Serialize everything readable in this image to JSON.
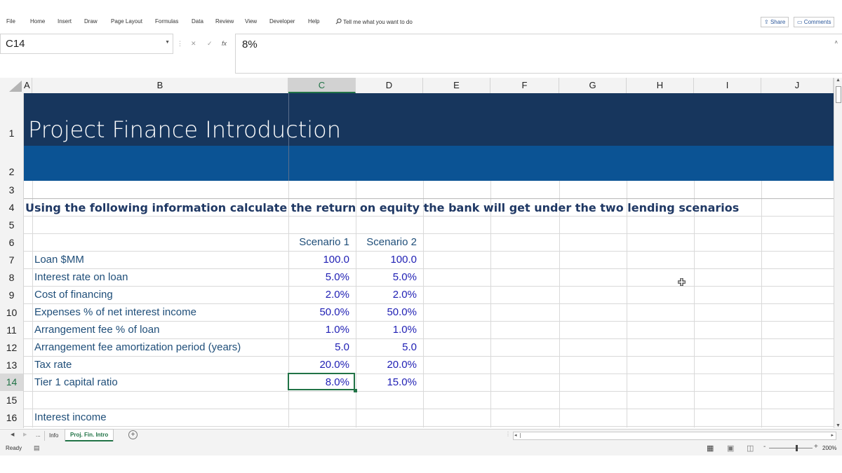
{
  "ribbon": {
    "tabs": [
      "File",
      "Home",
      "Insert",
      "Draw",
      "Page Layout",
      "Formulas",
      "Data",
      "Review",
      "View",
      "Developer",
      "Help"
    ],
    "tell_me": "Tell me what you want to do",
    "share": "Share",
    "comments": "Comments"
  },
  "formula_bar": {
    "name_box": "C14",
    "fx_label": "fx",
    "content": "8%"
  },
  "columns": [
    "A",
    "B",
    "C",
    "D",
    "E",
    "F",
    "G",
    "H",
    "I",
    "J"
  ],
  "rows": [
    "1",
    "2",
    "3",
    "4",
    "5",
    "6",
    "7",
    "8",
    "9",
    "10",
    "11",
    "12",
    "13",
    "14",
    "15",
    "16"
  ],
  "sheet": {
    "title": "Project Finance Introduction",
    "instruction": "Using the following information calculate the return on equity the bank will get under the two lending scenarios",
    "scenario_headers": [
      "Scenario 1",
      "Scenario 2"
    ],
    "inputs": [
      {
        "label": "Loan $MM",
        "s1": "100.0",
        "s2": "100.0"
      },
      {
        "label": "Interest rate on loan",
        "s1": "5.0%",
        "s2": "5.0%"
      },
      {
        "label": "Cost of financing",
        "s1": "2.0%",
        "s2": "2.0%"
      },
      {
        "label": "Expenses % of net interest income",
        "s1": "50.0%",
        "s2": "50.0%"
      },
      {
        "label": "Arrangement fee % of loan",
        "s1": "1.0%",
        "s2": "1.0%"
      },
      {
        "label": "Arrangement fee amortization period (years)",
        "s1": "5.0",
        "s2": "5.0"
      },
      {
        "label": "Tax rate",
        "s1": "20.0%",
        "s2": "20.0%"
      },
      {
        "label": "Tier 1 capital ratio",
        "s1": "8.0%",
        "s2": "15.0%"
      }
    ],
    "section_label": "Interest income"
  },
  "sheet_tabs": {
    "ellipsis": "...",
    "tabs": [
      "Info",
      "Proj. Fin. Intro"
    ],
    "active": "Proj. Fin. Intro",
    "add": "+"
  },
  "status": {
    "mode": "Ready",
    "zoom": "200%"
  },
  "colors": {
    "title_band": "#17365d",
    "sub_band": "#0b5394",
    "excel_green": "#217346",
    "label_text": "#1f4e79",
    "value_text": "#1f1fb4"
  }
}
